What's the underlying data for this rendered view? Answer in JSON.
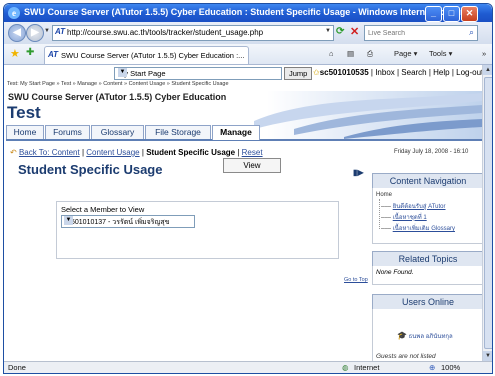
{
  "window": {
    "title": "SWU Course Server (ATutor 1.5.5) Cyber Education : Student Specific Usage - Windows Internet Explorer",
    "min": "_",
    "max": "□",
    "close": "✕"
  },
  "browser": {
    "address": "http://course.swu.ac.th/tools/tracker/student_usage.php",
    "search_placeholder": "Live Search",
    "tab_title": "SWU Course Server (ATutor 1.5.5) Cyber Education :...",
    "page_menu": "Page ▾",
    "tools_menu": "Tools ▾",
    "more": "»"
  },
  "status": {
    "left": "Done",
    "zone": "Internet",
    "zoom": "100%"
  },
  "jump": {
    "selected": "My Start Page",
    "button": "Jump"
  },
  "user": {
    "id": "sc501010535",
    "links": "| Inbox | Search | Help | Log-out"
  },
  "breadcrumb": "Test: My Start Page » Test » Manage » Content » Content Usage » Student Specific Usage",
  "course": {
    "header": "SWU Course Server (ATutor 1.5.5) Cyber Education",
    "name": "Test"
  },
  "tabs": [
    {
      "label": "Home"
    },
    {
      "label": "Forums"
    },
    {
      "label": "Glossary"
    },
    {
      "label": "File Storage"
    },
    {
      "label": "Manage"
    }
  ],
  "subnav": {
    "back": "Back To: Content",
    "usage": "Content Usage",
    "current": "Student Specific Usage",
    "sep": "|",
    "reset": "Reset"
  },
  "date": "Friday July 18, 2008 - 16:10",
  "page_title": "Student Specific Usage",
  "form": {
    "label": "Select a Member to View",
    "member": "sc501010137 - วรรัตน์ เพิ่มจริญสุข",
    "view_button": "View"
  },
  "goto_top": "Go to Top",
  "side": {
    "content_nav": "Content Navigation",
    "tree_home": "Home",
    "tree_items": [
      "ยินดีต้อนรับสู่ ATutor",
      "เนื้อหาชุดที่ 1",
      "เนื้อหาเพิ่มเติม Glossary"
    ],
    "related": "Related Topics",
    "none_found": "None Found.",
    "users_online": "Users Online",
    "online_user": "ธนพล อภินันทกุล",
    "guests": "Guests are not listed"
  }
}
